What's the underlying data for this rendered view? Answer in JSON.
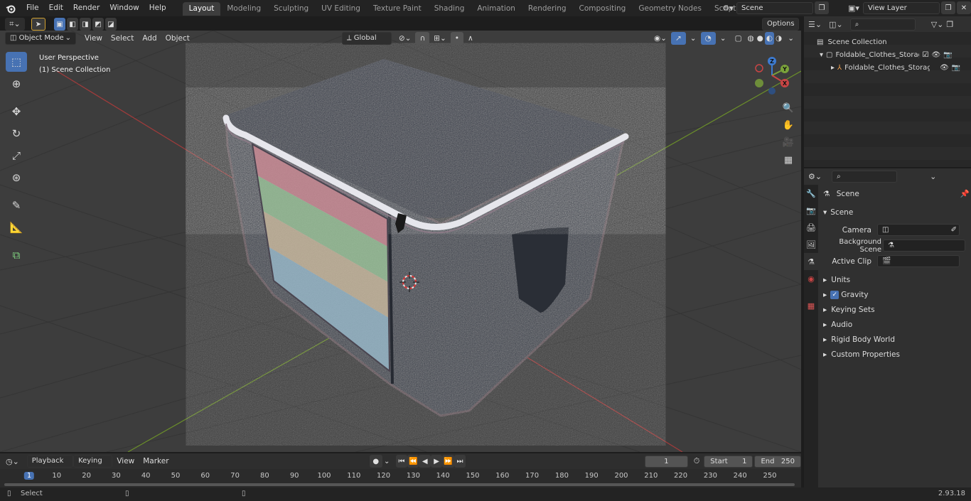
{
  "topbar": {
    "menus": [
      "File",
      "Edit",
      "Render",
      "Window",
      "Help"
    ],
    "workspaces": [
      "Layout",
      "Modeling",
      "Sculpting",
      "UV Editing",
      "Texture Paint",
      "Shading",
      "Animation",
      "Rendering",
      "Compositing",
      "Geometry Nodes",
      "Scripting"
    ],
    "active_workspace": "Layout",
    "add_tab": "+",
    "scene_value": "Scene",
    "view_layer_value": "View Layer"
  },
  "viewport_header": {
    "mode": "Object Mode",
    "menus": [
      "View",
      "Select",
      "Add",
      "Object"
    ],
    "transform_orientation": "Global",
    "options_label": "Options"
  },
  "viewport": {
    "perspective_label": "User Perspective",
    "collection_label": "(1) Scene Collection",
    "gizmo_axes": {
      "x": "X",
      "y": "Y",
      "z": "Z"
    }
  },
  "outliner": {
    "root": "Scene Collection",
    "items": [
      {
        "label": "Foldable_Clothes_Storage_Ba",
        "level": 1
      },
      {
        "label": "Foldable_Clothes_Storag",
        "level": 2
      }
    ]
  },
  "properties": {
    "context_title": "Scene",
    "panel_title": "Scene",
    "fields": [
      {
        "label": "Camera",
        "value": ""
      },
      {
        "label": "Background Scene",
        "value": ""
      },
      {
        "label": "Active Clip",
        "value": ""
      }
    ],
    "subpanels": [
      "Units",
      "Gravity",
      "Keying Sets",
      "Audio",
      "Rigid Body World",
      "Custom Properties"
    ],
    "gravity_checked": true
  },
  "timeline": {
    "menus": [
      "Playback",
      "Keying",
      "View",
      "Marker"
    ],
    "current_frame": "1",
    "start_label": "Start",
    "start_value": "1",
    "end_label": "End",
    "end_value": "250",
    "ruler": [
      "1",
      "10",
      "20",
      "30",
      "40",
      "50",
      "60",
      "70",
      "80",
      "90",
      "100",
      "110",
      "120",
      "130",
      "140",
      "150",
      "160",
      "170",
      "180",
      "190",
      "200",
      "210",
      "220",
      "230",
      "240",
      "250"
    ]
  },
  "statusbar": {
    "left_label": "Select",
    "version": "2.93.18"
  },
  "colors": {
    "accent": "#4772b3",
    "viewport_bg": "#3d3d3d",
    "panel_bg": "#303030",
    "axis_x": "#c94545",
    "axis_y": "#7aa23a",
    "axis_z": "#3d7bd1"
  }
}
